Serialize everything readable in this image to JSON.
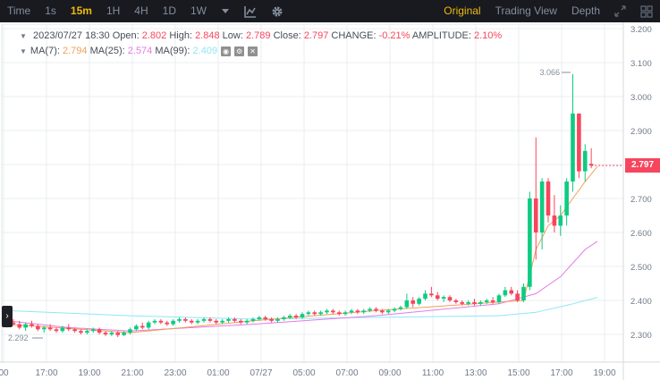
{
  "toolbar": {
    "time_label": "Time",
    "intervals": [
      "1s",
      "15m",
      "1H",
      "4H",
      "1D",
      "1W"
    ],
    "active_interval": "15m",
    "views": [
      "Original",
      "Trading View",
      "Depth"
    ],
    "active_view": "Original",
    "icons": [
      "chevron-down-icon",
      "indicator-chart-icon",
      "gear-icon",
      "fullscreen-icon",
      "grid-layout-icon"
    ]
  },
  "legend": {
    "datetime": "2023/07/27 18:30",
    "open_label": "Open:",
    "open": "2.802",
    "high_label": "High:",
    "high": "2.848",
    "low_label": "Low:",
    "low": "2.789",
    "close_label": "Close:",
    "close": "2.797",
    "change_label": "CHANGE:",
    "change": "-0.21%",
    "amplitude_label": "AMPLITUDE:",
    "amplitude": "2.10%",
    "ma7_label": "MA(7):",
    "ma7": "2.794",
    "ma25_label": "MA(25):",
    "ma25": "2.574",
    "ma99_label": "MA(99):",
    "ma99": "2.409"
  },
  "colors": {
    "up": "#0ecb81",
    "down": "#f6465d",
    "ma7": "#f0a05a",
    "ma25": "#e57ae6",
    "ma99": "#8fe6f5",
    "toolbar_bg": "#181a20",
    "accent": "#f0b90b"
  },
  "price_axis": {
    "ticks": [
      "3.200",
      "3.100",
      "3.000",
      "2.900",
      "2.800",
      "2.700",
      "2.600",
      "2.500",
      "2.400",
      "2.300"
    ],
    "current": "2.797"
  },
  "time_axis": {
    "ticks": [
      "00",
      "17:00",
      "19:00",
      "21:00",
      "23:00",
      "01:00",
      "07/27",
      "05:00",
      "07:00",
      "09:00",
      "11:00",
      "13:00",
      "15:00",
      "17:00",
      "19:00"
    ]
  },
  "annotations": {
    "max_label": "3.066",
    "min_label": "2.292"
  },
  "chart_data": {
    "type": "candlestick",
    "interval": "15m",
    "ylim": [
      2.25,
      3.2
    ],
    "candles": [
      [
        2.33,
        2.34,
        2.32,
        2.335
      ],
      [
        2.335,
        2.345,
        2.325,
        2.33
      ],
      [
        2.33,
        2.34,
        2.315,
        2.32
      ],
      [
        2.32,
        2.335,
        2.31,
        2.33
      ],
      [
        2.33,
        2.34,
        2.32,
        2.325
      ],
      [
        2.325,
        2.33,
        2.31,
        2.315
      ],
      [
        2.315,
        2.325,
        2.305,
        2.32
      ],
      [
        2.32,
        2.33,
        2.31,
        2.315
      ],
      [
        2.315,
        2.32,
        2.305,
        2.31
      ],
      [
        2.31,
        2.325,
        2.305,
        2.32
      ],
      [
        2.32,
        2.33,
        2.31,
        2.315
      ],
      [
        2.315,
        2.32,
        2.305,
        2.31
      ],
      [
        2.31,
        2.315,
        2.3,
        2.305
      ],
      [
        2.305,
        2.315,
        2.3,
        2.31
      ],
      [
        2.31,
        2.32,
        2.305,
        2.315
      ],
      [
        2.315,
        2.32,
        2.3,
        2.305
      ],
      [
        2.305,
        2.31,
        2.295,
        2.3
      ],
      [
        2.3,
        2.31,
        2.295,
        2.305
      ],
      [
        2.305,
        2.31,
        2.292,
        2.298
      ],
      [
        2.298,
        2.31,
        2.295,
        2.305
      ],
      [
        2.305,
        2.32,
        2.3,
        2.315
      ],
      [
        2.315,
        2.33,
        2.31,
        2.325
      ],
      [
        2.325,
        2.335,
        2.315,
        2.32
      ],
      [
        2.32,
        2.34,
        2.315,
        2.335
      ],
      [
        2.335,
        2.345,
        2.33,
        2.34
      ],
      [
        2.34,
        2.345,
        2.33,
        2.335
      ],
      [
        2.335,
        2.34,
        2.325,
        2.33
      ],
      [
        2.33,
        2.345,
        2.325,
        2.34
      ],
      [
        2.34,
        2.35,
        2.335,
        2.345
      ],
      [
        2.345,
        2.35,
        2.335,
        2.34
      ],
      [
        2.34,
        2.345,
        2.33,
        2.335
      ],
      [
        2.335,
        2.345,
        2.33,
        2.34
      ],
      [
        2.34,
        2.35,
        2.335,
        2.345
      ],
      [
        2.345,
        2.35,
        2.335,
        2.34
      ],
      [
        2.34,
        2.345,
        2.33,
        2.335
      ],
      [
        2.335,
        2.345,
        2.33,
        2.34
      ],
      [
        2.34,
        2.35,
        2.335,
        2.345
      ],
      [
        2.345,
        2.35,
        2.335,
        2.34
      ],
      [
        2.34,
        2.345,
        2.33,
        2.335
      ],
      [
        2.335,
        2.345,
        2.33,
        2.34
      ],
      [
        2.34,
        2.35,
        2.335,
        2.345
      ],
      [
        2.345,
        2.355,
        2.34,
        2.35
      ],
      [
        2.35,
        2.355,
        2.34,
        2.345
      ],
      [
        2.345,
        2.35,
        2.335,
        2.34
      ],
      [
        2.34,
        2.35,
        2.335,
        2.345
      ],
      [
        2.345,
        2.355,
        2.34,
        2.35
      ],
      [
        2.35,
        2.36,
        2.345,
        2.355
      ],
      [
        2.355,
        2.36,
        2.345,
        2.35
      ],
      [
        2.35,
        2.365,
        2.345,
        2.36
      ],
      [
        2.36,
        2.37,
        2.355,
        2.365
      ],
      [
        2.365,
        2.37,
        2.355,
        2.36
      ],
      [
        2.36,
        2.37,
        2.355,
        2.365
      ],
      [
        2.365,
        2.375,
        2.36,
        2.37
      ],
      [
        2.37,
        2.375,
        2.36,
        2.365
      ],
      [
        2.365,
        2.37,
        2.355,
        2.36
      ],
      [
        2.36,
        2.37,
        2.355,
        2.365
      ],
      [
        2.365,
        2.375,
        2.36,
        2.37
      ],
      [
        2.37,
        2.375,
        2.36,
        2.365
      ],
      [
        2.365,
        2.375,
        2.36,
        2.37
      ],
      [
        2.37,
        2.38,
        2.365,
        2.375
      ],
      [
        2.375,
        2.38,
        2.365,
        2.37
      ],
      [
        2.37,
        2.375,
        2.36,
        2.365
      ],
      [
        2.365,
        2.375,
        2.36,
        2.37
      ],
      [
        2.37,
        2.38,
        2.365,
        2.375
      ],
      [
        2.375,
        2.385,
        2.37,
        2.38
      ],
      [
        2.38,
        2.42,
        2.375,
        2.4
      ],
      [
        2.4,
        2.41,
        2.38,
        2.39
      ],
      [
        2.39,
        2.41,
        2.385,
        2.405
      ],
      [
        2.405,
        2.43,
        2.4,
        2.42
      ],
      [
        2.42,
        2.44,
        2.41,
        2.415
      ],
      [
        2.415,
        2.425,
        2.4,
        2.405
      ],
      [
        2.405,
        2.415,
        2.395,
        2.41
      ],
      [
        2.41,
        2.415,
        2.395,
        2.4
      ],
      [
        2.4,
        2.405,
        2.39,
        2.395
      ],
      [
        2.395,
        2.4,
        2.385,
        2.39
      ],
      [
        2.39,
        2.4,
        2.385,
        2.395
      ],
      [
        2.395,
        2.405,
        2.385,
        2.39
      ],
      [
        2.39,
        2.4,
        2.385,
        2.395
      ],
      [
        2.395,
        2.405,
        2.39,
        2.4
      ],
      [
        2.4,
        2.41,
        2.39,
        2.395
      ],
      [
        2.395,
        2.42,
        2.39,
        2.415
      ],
      [
        2.415,
        2.44,
        2.41,
        2.43
      ],
      [
        2.43,
        2.44,
        2.415,
        2.42
      ],
      [
        2.42,
        2.43,
        2.395,
        2.4
      ],
      [
        2.4,
        2.45,
        2.395,
        2.44
      ],
      [
        2.44,
        2.72,
        2.43,
        2.7
      ],
      [
        2.7,
        2.88,
        2.52,
        2.6
      ],
      [
        2.6,
        2.76,
        2.55,
        2.75
      ],
      [
        2.75,
        2.76,
        2.63,
        2.65
      ],
      [
        2.65,
        2.71,
        2.6,
        2.62
      ],
      [
        2.62,
        2.68,
        2.59,
        2.65
      ],
      [
        2.65,
        2.76,
        2.62,
        2.75
      ],
      [
        2.75,
        3.066,
        2.72,
        2.95
      ],
      [
        2.95,
        2.95,
        2.76,
        2.78
      ],
      [
        2.78,
        2.86,
        2.75,
        2.84
      ],
      [
        2.802,
        2.848,
        2.789,
        2.797
      ]
    ],
    "ma7": [
      [
        0,
        2.33
      ],
      [
        20,
        2.305
      ],
      [
        40,
        2.34
      ],
      [
        60,
        2.37
      ],
      [
        80,
        2.395
      ],
      [
        84,
        2.4
      ],
      [
        86,
        2.55
      ],
      [
        88,
        2.62
      ],
      [
        90,
        2.65
      ],
      [
        94,
        2.75
      ],
      [
        96,
        2.794
      ]
    ],
    "ma25": [
      [
        0,
        2.34
      ],
      [
        10,
        2.32
      ],
      [
        20,
        2.31
      ],
      [
        40,
        2.33
      ],
      [
        60,
        2.355
      ],
      [
        80,
        2.39
      ],
      [
        86,
        2.42
      ],
      [
        90,
        2.47
      ],
      [
        94,
        2.55
      ],
      [
        96,
        2.574
      ]
    ],
    "ma99": [
      [
        0,
        2.37
      ],
      [
        20,
        2.355
      ],
      [
        40,
        2.345
      ],
      [
        60,
        2.35
      ],
      [
        80,
        2.355
      ],
      [
        86,
        2.365
      ],
      [
        92,
        2.39
      ],
      [
        96,
        2.409
      ]
    ]
  }
}
